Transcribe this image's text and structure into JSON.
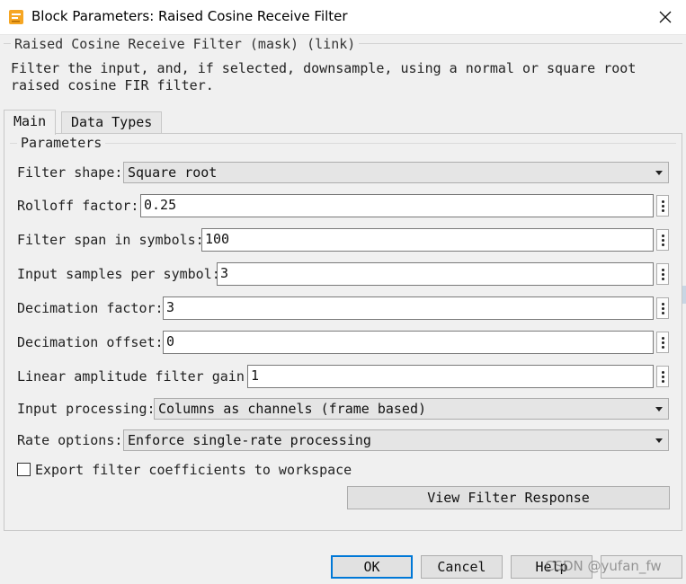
{
  "window": {
    "title": "Block Parameters: Raised Cosine Receive Filter",
    "close_icon": "close-icon",
    "app_icon": "simulink-icon"
  },
  "mask": {
    "header": "Raised Cosine Receive Filter (mask) (link)",
    "description": "Filter the input, and, if selected, downsample, using a normal or square root raised cosine FIR filter."
  },
  "tabs": [
    {
      "label": "Main",
      "active": true
    },
    {
      "label": "Data Types",
      "active": false
    }
  ],
  "parameters": {
    "legend": "Parameters",
    "filter_shape": {
      "label": "Filter shape:",
      "value": "Square root"
    },
    "rolloff": {
      "label": "Rolloff factor:",
      "value": "0.25"
    },
    "span": {
      "label": "Filter span in symbols:",
      "value": "100"
    },
    "sps": {
      "label": "Input samples per symbol:",
      "value": "3"
    },
    "decimation_factor": {
      "label": "Decimation factor:",
      "value": "3"
    },
    "decimation_offset": {
      "label": "Decimation offset:",
      "value": "0"
    },
    "gain": {
      "label": "Linear amplitude filter gain:",
      "value": "1"
    },
    "input_processing": {
      "label": "Input processing:",
      "value": "Columns as channels (frame based)"
    },
    "rate_options": {
      "label": "Rate options:",
      "value": "Enforce single-rate processing"
    },
    "export": {
      "label": "Export filter coefficients to workspace",
      "checked": false
    },
    "view_response": "View Filter Response"
  },
  "footer": {
    "ok": "OK",
    "cancel": "Cancel",
    "help": "Help"
  },
  "watermark": "CSDN @yufan_fw",
  "colors": {
    "accent": "#0078d7",
    "background": "#f0f0f0"
  }
}
